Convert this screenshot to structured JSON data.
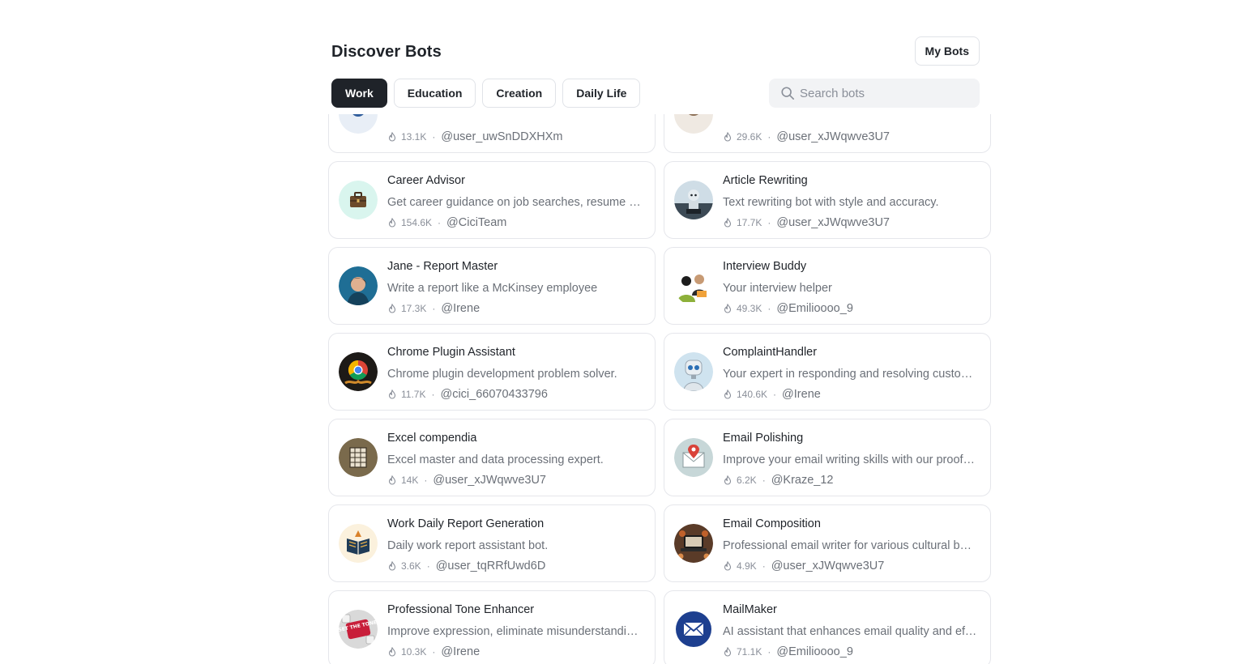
{
  "header": {
    "title": "Discover Bots",
    "my_bots_label": "My Bots"
  },
  "tabs": [
    {
      "label": "Work",
      "active": true
    },
    {
      "label": "Education",
      "active": false
    },
    {
      "label": "Creation",
      "active": false
    },
    {
      "label": "Daily Life",
      "active": false
    }
  ],
  "search": {
    "placeholder": "Search bots",
    "value": ""
  },
  "bots": [
    {
      "name": "",
      "description": "",
      "uses": "13.1K",
      "author": "@user_uwSnDDXHXm",
      "avatar_icon": "partial-avatar-icon"
    },
    {
      "name": "",
      "description": "",
      "uses": "29.6K",
      "author": "@user_xJWqwve3U7",
      "avatar_icon": "partial-avatar-icon"
    },
    {
      "name": "Career Advisor",
      "description": "Get career guidance on job searches, resume writing and interview preparation.",
      "uses": "154.6K",
      "author": "@CiciTeam",
      "avatar_icon": "briefcase-icon"
    },
    {
      "name": "Article Rewriting",
      "description": "Text rewriting bot with style and accuracy.",
      "uses": "17.7K",
      "author": "@user_xJWqwve3U7",
      "avatar_icon": "robot-writer-icon"
    },
    {
      "name": "Jane - Report Master",
      "description": "Write a report like a McKinsey employee",
      "uses": "17.3K",
      "author": "@Irene",
      "avatar_icon": "person-portrait-icon"
    },
    {
      "name": "Interview Buddy",
      "description": "Your interview helper",
      "uses": "49.3K",
      "author": "@Emilioooo_9",
      "avatar_icon": "interview-people-icon"
    },
    {
      "name": "Chrome Plugin Assistant",
      "description": "Chrome plugin development problem solver.",
      "uses": "11.7K",
      "author": "@cici_66070433796",
      "avatar_icon": "chrome-logo-icon"
    },
    {
      "name": "ComplaintHandler",
      "description": "Your expert in responding and resolving customer complaints.",
      "uses": "140.6K",
      "author": "@Irene",
      "avatar_icon": "robot-head-icon"
    },
    {
      "name": "Excel compendia",
      "description": "Excel master and data processing expert.",
      "uses": "14K",
      "author": "@user_xJWqwve3U7",
      "avatar_icon": "spreadsheet-icon"
    },
    {
      "name": "Email Polishing",
      "description": "Improve your email writing skills with our proofreading service.",
      "uses": "6.2K",
      "author": "@Kraze_12",
      "avatar_icon": "envelope-pin-icon"
    },
    {
      "name": "Work Daily Report Generation",
      "description": "Daily work report assistant bot.",
      "uses": "3.6K",
      "author": "@user_tqRRfUwd6D",
      "avatar_icon": "book-emblem-icon"
    },
    {
      "name": "Email Composition",
      "description": "Professional email writer for various cultural backgrounds.",
      "uses": "4.9K",
      "author": "@user_xJWqwve3U7",
      "avatar_icon": "laptop-hands-icon"
    },
    {
      "name": "Professional Tone Enhancer",
      "description": "Improve expression, eliminate misunderstandings and sound professional.",
      "uses": "10.3K",
      "author": "@Irene",
      "avatar_icon": "set-the-tone-key-icon",
      "avatar_text": "SET THE TONE"
    },
    {
      "name": "MailMaker",
      "description": "AI assistant that enhances email quality and efficiency.",
      "uses": "71.1K",
      "author": "@Emilioooo_9",
      "avatar_icon": "mail-envelope-icon"
    }
  ],
  "colors": {
    "accent": "#1f2329",
    "card_border": "#e5e6eb",
    "search_bg": "#f2f3f5"
  }
}
